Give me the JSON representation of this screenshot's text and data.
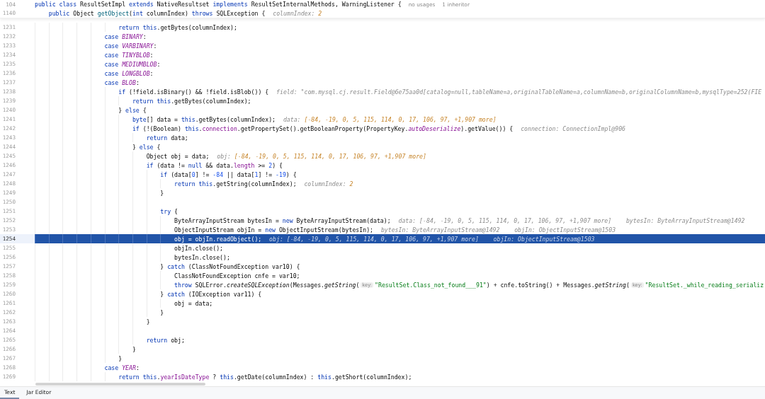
{
  "sticky_header": [
    {
      "number": "104",
      "tokens": [
        {
          "kind": "kw",
          "text": "public class "
        },
        {
          "kind": "txt",
          "text": "ResultSetImpl "
        },
        {
          "kind": "kw",
          "text": "extends "
        },
        {
          "kind": "txt",
          "text": "NativeResultset "
        },
        {
          "kind": "kw",
          "text": "implements "
        },
        {
          "kind": "txt",
          "text": "ResultSetInternalMethods, WarningListener {"
        },
        {
          "kind": "usage",
          "text": "no usages"
        },
        {
          "kind": "usage",
          "text": "1 inheritor"
        }
      ]
    },
    {
      "number": "1140",
      "tokens": [
        {
          "kind": "kw",
          "text": "    public "
        },
        {
          "kind": "txt",
          "text": "Object "
        },
        {
          "kind": "decl",
          "text": "getObject"
        },
        {
          "kind": "txt",
          "text": "("
        },
        {
          "kind": "kw",
          "text": "int "
        },
        {
          "kind": "txt",
          "text": "columnIndex) "
        },
        {
          "kind": "kw",
          "text": "throws "
        },
        {
          "kind": "txt",
          "text": "SQLException {"
        },
        {
          "kind": "hint",
          "text": "columnIndex: ",
          "value": "2"
        }
      ]
    }
  ],
  "lines": [
    {
      "number": "1231",
      "selected": false,
      "tokens": [
        {
          "kind": "kw",
          "text": "                        return this"
        },
        {
          "kind": "txt",
          "text": ".getBytes(columnIndex);"
        }
      ]
    },
    {
      "number": "1232",
      "selected": false,
      "tokens": [
        {
          "kind": "kw",
          "text": "                    case "
        },
        {
          "kind": "const",
          "text": "BINARY"
        },
        {
          "kind": "txt",
          "text": ":"
        }
      ]
    },
    {
      "number": "1233",
      "selected": false,
      "tokens": [
        {
          "kind": "kw",
          "text": "                    case "
        },
        {
          "kind": "const",
          "text": "VARBINARY"
        },
        {
          "kind": "txt",
          "text": ":"
        }
      ]
    },
    {
      "number": "1234",
      "selected": false,
      "tokens": [
        {
          "kind": "kw",
          "text": "                    case "
        },
        {
          "kind": "const",
          "text": "TINYBLOB"
        },
        {
          "kind": "txt",
          "text": ":"
        }
      ]
    },
    {
      "number": "1235",
      "selected": false,
      "tokens": [
        {
          "kind": "kw",
          "text": "                    case "
        },
        {
          "kind": "const",
          "text": "MEDIUMBLOB"
        },
        {
          "kind": "txt",
          "text": ":"
        }
      ]
    },
    {
      "number": "1236",
      "selected": false,
      "tokens": [
        {
          "kind": "kw",
          "text": "                    case "
        },
        {
          "kind": "const",
          "text": "LONGBLOB"
        },
        {
          "kind": "txt",
          "text": ":"
        }
      ]
    },
    {
      "number": "1237",
      "selected": false,
      "tokens": [
        {
          "kind": "kw",
          "text": "                    case "
        },
        {
          "kind": "const",
          "text": "BLOB"
        },
        {
          "kind": "txt",
          "text": ":"
        }
      ]
    },
    {
      "number": "1238",
      "selected": false,
      "tokens": [
        {
          "kind": "kw",
          "text": "                        if "
        },
        {
          "kind": "txt",
          "text": "(!field.isBinary() && !field.isBlob()) {"
        },
        {
          "kind": "hint",
          "text": "field: \"com.mysql.cj.result.Field@6e75aa0d[catalog=null,tableName=a,originalTableName=a,columnName=b,originalColumnName=b,mysqlType=252(FIE"
        }
      ]
    },
    {
      "number": "1239",
      "selected": false,
      "tokens": [
        {
          "kind": "kw",
          "text": "                            return this"
        },
        {
          "kind": "txt",
          "text": ".getBytes(columnIndex);"
        }
      ]
    },
    {
      "number": "1240",
      "selected": false,
      "tokens": [
        {
          "kind": "txt",
          "text": "                        } "
        },
        {
          "kind": "kw",
          "text": "else"
        },
        {
          "kind": "txt",
          "text": " {"
        }
      ]
    },
    {
      "number": "1241",
      "selected": false,
      "tokens": [
        {
          "kind": "kw",
          "text": "                            byte"
        },
        {
          "kind": "txt",
          "text": "[] data = "
        },
        {
          "kind": "kw",
          "text": "this"
        },
        {
          "kind": "txt",
          "text": ".getBytes(columnIndex);"
        },
        {
          "kind": "hint",
          "text": "data: ",
          "value": "[-84, -19, 0, 5, 115, 114, 0, 17, 106, 97, +1,907 more]"
        }
      ]
    },
    {
      "number": "1242",
      "selected": false,
      "tokens": [
        {
          "kind": "kw",
          "text": "                            if "
        },
        {
          "kind": "txt",
          "text": "(!(Boolean) "
        },
        {
          "kind": "kw",
          "text": "this"
        },
        {
          "kind": "txt",
          "text": "."
        },
        {
          "kind": "field",
          "text": "connection"
        },
        {
          "kind": "txt",
          "text": ".getPropertySet().getBooleanProperty(PropertyKey."
        },
        {
          "kind": "const",
          "text": "autoDeserialize"
        },
        {
          "kind": "txt",
          "text": ").getValue()) {"
        },
        {
          "kind": "hint",
          "text": "connection: ConnectionImpl@906"
        }
      ]
    },
    {
      "number": "1243",
      "selected": false,
      "tokens": [
        {
          "kind": "kw",
          "text": "                                return "
        },
        {
          "kind": "txt",
          "text": "data;"
        }
      ]
    },
    {
      "number": "1244",
      "selected": false,
      "tokens": [
        {
          "kind": "txt",
          "text": "                            } "
        },
        {
          "kind": "kw",
          "text": "else"
        },
        {
          "kind": "txt",
          "text": " {"
        }
      ]
    },
    {
      "number": "1245",
      "selected": false,
      "tokens": [
        {
          "kind": "txt",
          "text": "                                Object obj = data;"
        },
        {
          "kind": "hint",
          "text": "obj: ",
          "value": "[-84, -19, 0, 5, 115, 114, 0, 17, 106, 97, +1,907 more]"
        }
      ]
    },
    {
      "number": "1246",
      "selected": false,
      "tokens": [
        {
          "kind": "kw",
          "text": "                                if "
        },
        {
          "kind": "txt",
          "text": "(data != "
        },
        {
          "kind": "kw",
          "text": "null"
        },
        {
          "kind": "txt",
          "text": " && data."
        },
        {
          "kind": "field",
          "text": "length"
        },
        {
          "kind": "txt",
          "text": " >= "
        },
        {
          "kind": "num",
          "text": "2"
        },
        {
          "kind": "txt",
          "text": ") {"
        }
      ]
    },
    {
      "number": "1247",
      "selected": false,
      "tokens": [
        {
          "kind": "kw",
          "text": "                                    if "
        },
        {
          "kind": "txt",
          "text": "(data["
        },
        {
          "kind": "num",
          "text": "0"
        },
        {
          "kind": "txt",
          "text": "] != "
        },
        {
          "kind": "num",
          "text": "-84"
        },
        {
          "kind": "txt",
          "text": " || data["
        },
        {
          "kind": "num",
          "text": "1"
        },
        {
          "kind": "txt",
          "text": "] != "
        },
        {
          "kind": "num",
          "text": "-19"
        },
        {
          "kind": "txt",
          "text": ") {"
        }
      ]
    },
    {
      "number": "1248",
      "selected": false,
      "tokens": [
        {
          "kind": "kw",
          "text": "                                        return this"
        },
        {
          "kind": "txt",
          "text": ".getString(columnIndex);"
        },
        {
          "kind": "hint",
          "text": "columnIndex: ",
          "value": "2"
        }
      ]
    },
    {
      "number": "1249",
      "selected": false,
      "tokens": [
        {
          "kind": "txt",
          "text": "                                    }"
        }
      ]
    },
    {
      "number": "1250",
      "selected": false
    },
    {
      "number": "1251",
      "selected": false,
      "tokens": [
        {
          "kind": "kw",
          "text": "                                    try"
        },
        {
          "kind": "txt",
          "text": " {"
        }
      ]
    },
    {
      "number": "1252",
      "selected": false,
      "tokens": [
        {
          "kind": "txt",
          "text": "                                        ByteArrayInputStream bytesIn = "
        },
        {
          "kind": "kw",
          "text": "new"
        },
        {
          "kind": "txt",
          "text": " ByteArrayInputStream(data);"
        },
        {
          "kind": "hint",
          "text": "data: [-84, -19, 0, 5, 115, 114, 0, 17, 106, 97, +1,907 more]"
        },
        {
          "kind": "hint",
          "text": "bytesIn: ByteArrayInputStream@1492"
        }
      ]
    },
    {
      "number": "1253",
      "selected": false,
      "tokens": [
        {
          "kind": "txt",
          "text": "                                        ObjectInputStream objIn = "
        },
        {
          "kind": "kw",
          "text": "new"
        },
        {
          "kind": "txt",
          "text": " ObjectInputStream(bytesIn);"
        },
        {
          "kind": "hint",
          "text": "bytesIn: ByteArrayInputStream@1492"
        },
        {
          "kind": "hint",
          "text": "objIn: ObjectInputStream@1503"
        }
      ]
    },
    {
      "number": "1254",
      "selected": true,
      "tokens": [
        {
          "kind": "txt",
          "text": "                                        obj = objIn.readObject();"
        },
        {
          "kind": "hint",
          "text": "obj: [-84, -19, 0, 5, 115, 114, 0, 17, 106, 97, +1,907 more]"
        },
        {
          "kind": "hint",
          "text": "objIn: ObjectInputStream@1503"
        }
      ]
    },
    {
      "number": "1255",
      "selected": false,
      "tokens": [
        {
          "kind": "txt",
          "text": "                                        objIn.close();"
        }
      ]
    },
    {
      "number": "1256",
      "selected": false,
      "tokens": [
        {
          "kind": "txt",
          "text": "                                        bytesIn.close();"
        }
      ]
    },
    {
      "number": "1257",
      "selected": false,
      "tokens": [
        {
          "kind": "txt",
          "text": "                                    } "
        },
        {
          "kind": "kw",
          "text": "catch"
        },
        {
          "kind": "txt",
          "text": " (ClassNotFoundException var10) {"
        }
      ]
    },
    {
      "number": "1258",
      "selected": false,
      "tokens": [
        {
          "kind": "txt",
          "text": "                                        ClassNotFoundException cnfe = var10;"
        }
      ]
    },
    {
      "number": "1259",
      "selected": false,
      "tokens": [
        {
          "kind": "kw",
          "text": "                                        throw "
        },
        {
          "kind": "txt",
          "text": "SQLError."
        },
        {
          "kind": "method",
          "text": "createSQLException"
        },
        {
          "kind": "txt",
          "text": "(Messages."
        },
        {
          "kind": "method",
          "text": "getString"
        },
        {
          "kind": "txt",
          "text": "("
        },
        {
          "kind": "chip",
          "text": "key:"
        },
        {
          "kind": "str",
          "text": "\"ResultSet.Class_not_found___91\""
        },
        {
          "kind": "txt",
          "text": ") + cnfe.toString() + Messages."
        },
        {
          "kind": "method",
          "text": "getString"
        },
        {
          "kind": "txt",
          "text": "("
        },
        {
          "kind": "chip",
          "text": "key:"
        },
        {
          "kind": "str",
          "text": "\"ResultSet._while_reading_serializ"
        }
      ]
    },
    {
      "number": "1260",
      "selected": false,
      "tokens": [
        {
          "kind": "txt",
          "text": "                                    } "
        },
        {
          "kind": "kw",
          "text": "catch"
        },
        {
          "kind": "txt",
          "text": " (IOException var11) {"
        }
      ]
    },
    {
      "number": "1261",
      "selected": false,
      "tokens": [
        {
          "kind": "txt",
          "text": "                                        obj = data;"
        }
      ]
    },
    {
      "number": "1262",
      "selected": false,
      "tokens": [
        {
          "kind": "txt",
          "text": "                                    }"
        }
      ]
    },
    {
      "number": "1263",
      "selected": false,
      "tokens": [
        {
          "kind": "txt",
          "text": "                                }"
        }
      ]
    },
    {
      "number": "1264",
      "selected": false
    },
    {
      "number": "1265",
      "selected": false,
      "tokens": [
        {
          "kind": "kw",
          "text": "                                return "
        },
        {
          "kind": "txt",
          "text": "obj;"
        }
      ]
    },
    {
      "number": "1266",
      "selected": false,
      "tokens": [
        {
          "kind": "txt",
          "text": "                            }"
        }
      ]
    },
    {
      "number": "1267",
      "selected": false,
      "tokens": [
        {
          "kind": "txt",
          "text": "                        }"
        }
      ]
    },
    {
      "number": "1268",
      "selected": false,
      "tokens": [
        {
          "kind": "kw",
          "text": "                    case "
        },
        {
          "kind": "const",
          "text": "YEAR"
        },
        {
          "kind": "txt",
          "text": ":"
        }
      ]
    },
    {
      "number": "1269",
      "selected": false,
      "tokens": [
        {
          "kind": "kw",
          "text": "                        return this"
        },
        {
          "kind": "txt",
          "text": "."
        },
        {
          "kind": "field",
          "text": "yearIsDateType"
        },
        {
          "kind": "txt",
          "text": " ? "
        },
        {
          "kind": "kw",
          "text": "this"
        },
        {
          "kind": "txt",
          "text": ".getDate(columnIndex) : "
        },
        {
          "kind": "kw",
          "text": "this"
        },
        {
          "kind": "txt",
          "text": ".getShort(columnIndex);"
        }
      ]
    }
  ],
  "tabs": [
    {
      "label": "Text",
      "selected": true
    },
    {
      "label": "Jar Editor",
      "selected": false
    }
  ]
}
